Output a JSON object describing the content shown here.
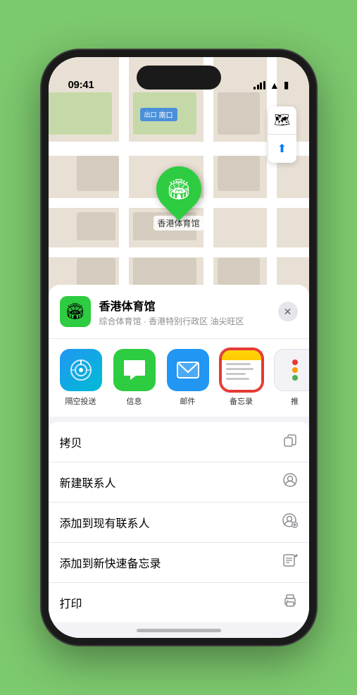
{
  "status_bar": {
    "time": "09:41",
    "signal_label": "signal",
    "wifi_label": "wifi",
    "battery_label": "battery"
  },
  "map": {
    "location_label": "南口",
    "pin_label": "香港体育馆",
    "map_btn_layers": "🗺",
    "map_btn_location": "↗"
  },
  "venue_header": {
    "name": "香港体育馆",
    "subtitle": "综合体育馆 · 香港特别行政区 油尖旺区",
    "close_label": "✕"
  },
  "share_apps": [
    {
      "id": "airdrop",
      "label": "隔空投送",
      "type": "airdrop"
    },
    {
      "id": "messages",
      "label": "信息",
      "type": "messages"
    },
    {
      "id": "mail",
      "label": "邮件",
      "type": "mail"
    },
    {
      "id": "notes",
      "label": "备忘录",
      "type": "notes"
    },
    {
      "id": "more",
      "label": "推",
      "type": "more"
    }
  ],
  "actions": [
    {
      "label": "拷贝",
      "icon": "📋"
    },
    {
      "label": "新建联系人",
      "icon": "👤"
    },
    {
      "label": "添加到现有联系人",
      "icon": "👤"
    },
    {
      "label": "添加到新快速备忘录",
      "icon": "📝"
    },
    {
      "label": "打印",
      "icon": "🖨"
    }
  ]
}
